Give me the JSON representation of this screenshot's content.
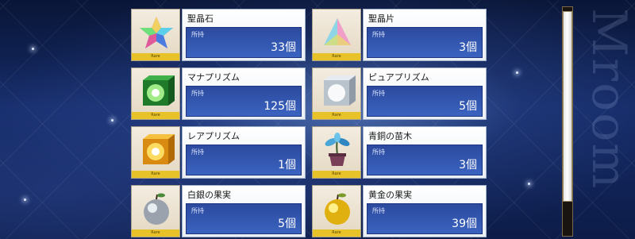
{
  "inventory": {
    "held_label": "所持",
    "rare_tag": "Rare",
    "items": [
      {
        "name": "聖晶石",
        "count": "33個",
        "icon": "saint-quartz-icon"
      },
      {
        "name": "聖晶片",
        "count": "3個",
        "icon": "saint-quartz-fragment-icon"
      },
      {
        "name": "マナプリズム",
        "count": "125個",
        "icon": "mana-prism-icon"
      },
      {
        "name": "ピュアプリズム",
        "count": "5個",
        "icon": "pure-prism-icon"
      },
      {
        "name": "レアプリズム",
        "count": "1個",
        "icon": "rare-prism-icon"
      },
      {
        "name": "青銅の苗木",
        "count": "3個",
        "icon": "bronze-sapling-icon"
      },
      {
        "name": "白銀の果実",
        "count": "5個",
        "icon": "silver-apple-icon"
      },
      {
        "name": "黄金の果実",
        "count": "39個",
        "icon": "golden-apple-icon"
      }
    ]
  },
  "background": {
    "watermark": "Mroom"
  },
  "colors": {
    "qty_panel": "#2c4a9e",
    "rare_strip": "#e8c229"
  }
}
